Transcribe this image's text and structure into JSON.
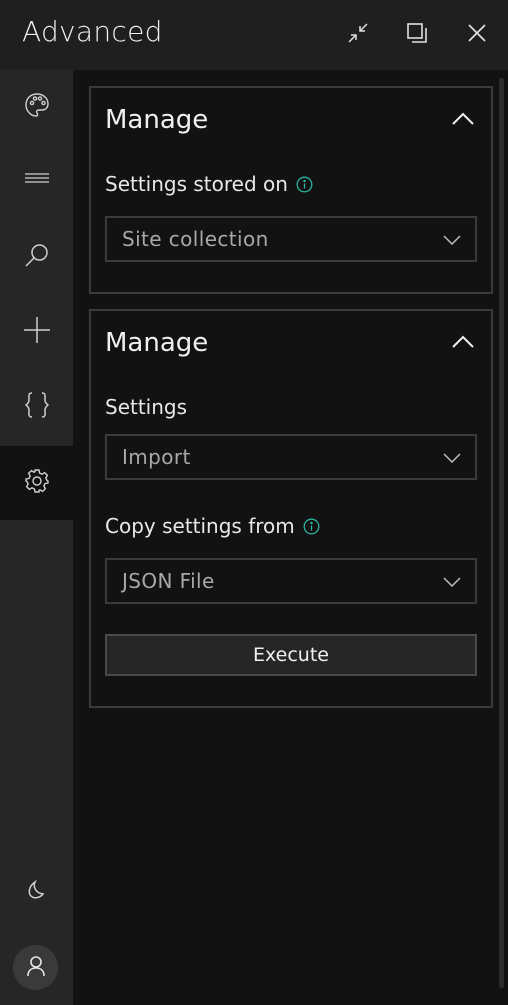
{
  "window": {
    "title": "Advanced",
    "controls": {
      "collapse_icon": "collapse-arrows-icon",
      "restore_icon": "restore-window-icon",
      "close_icon": "close-icon"
    }
  },
  "sidebar": {
    "items": [
      {
        "icon": "palette-icon",
        "active": false
      },
      {
        "icon": "menu-lines-icon",
        "active": false
      },
      {
        "icon": "search-icon",
        "active": false
      },
      {
        "icon": "plus-icon",
        "active": false
      },
      {
        "icon": "braces-icon",
        "active": false
      },
      {
        "icon": "gear-icon",
        "active": true
      }
    ],
    "bottom": {
      "theme_icon": "moon-icon",
      "avatar_icon": "person-icon"
    }
  },
  "panels": [
    {
      "title": "Manage",
      "fields": [
        {
          "label": "Settings stored on",
          "info": true,
          "value": "Site collection"
        }
      ]
    },
    {
      "title": "Manage",
      "fields": [
        {
          "label": "Settings",
          "info": false,
          "value": "Import"
        },
        {
          "label": "Copy settings from",
          "info": true,
          "value": "JSON File"
        }
      ],
      "action_label": "Execute"
    }
  ],
  "colors": {
    "accent_info": "#2bb5a0",
    "header_bg": "#1f1f1f",
    "sidebar_bg": "#262626",
    "content_bg": "#121212",
    "border": "#3a3a3a"
  }
}
